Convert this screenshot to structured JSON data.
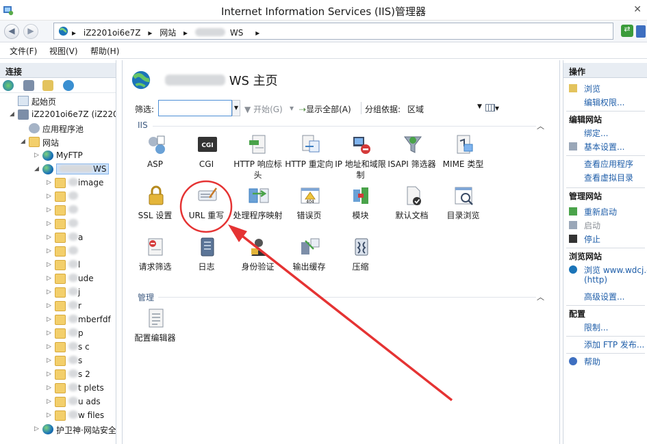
{
  "window": {
    "title": "Internet Information Services (IIS)管理器"
  },
  "address": {
    "crumbs": [
      "iZ2201oi6e7Z",
      "网站",
      "WS"
    ]
  },
  "menu": {
    "file": "文件(F)",
    "view": "视图(V)",
    "help": "帮助(H)"
  },
  "connections": {
    "header": "连接",
    "tree": [
      {
        "label": "起始页",
        "level": 1,
        "kind": "page"
      },
      {
        "label": "iZ2201oi6e7Z (iZ2201",
        "level": 1,
        "kind": "server"
      },
      {
        "label": "应用程序池",
        "level": 2,
        "kind": "pool"
      },
      {
        "label": "网站",
        "level": 2,
        "kind": "folder"
      },
      {
        "label": "MyFTP",
        "level": 3,
        "kind": "site"
      },
      {
        "label": "WS",
        "level": 3,
        "kind": "site-selected"
      },
      {
        "label": "image",
        "level": 4,
        "kind": "folder"
      },
      {
        "label": "",
        "level": 4,
        "kind": "folder"
      },
      {
        "label": "",
        "level": 4,
        "kind": "folder"
      },
      {
        "label": "",
        "level": 4,
        "kind": "folder"
      },
      {
        "label": "a",
        "level": 4,
        "kind": "folder"
      },
      {
        "label": "",
        "level": 4,
        "kind": "folder"
      },
      {
        "label": "l",
        "level": 4,
        "kind": "folder"
      },
      {
        "label": "ude",
        "level": 4,
        "kind": "folder"
      },
      {
        "label": "j",
        "level": 4,
        "kind": "folder"
      },
      {
        "label": "r",
        "level": 4,
        "kind": "folder"
      },
      {
        "label": "mberfdf",
        "level": 4,
        "kind": "folder"
      },
      {
        "label": "p",
        "level": 4,
        "kind": "folder"
      },
      {
        "label": "s  c",
        "level": 4,
        "kind": "folder"
      },
      {
        "label": "s",
        "level": 4,
        "kind": "folder"
      },
      {
        "label": "s  2",
        "level": 4,
        "kind": "folder"
      },
      {
        "label": "t  plets",
        "level": 4,
        "kind": "folder"
      },
      {
        "label": "u  ads",
        "level": 4,
        "kind": "folder"
      },
      {
        "label": "w  files",
        "level": 4,
        "kind": "folder"
      },
      {
        "label": "护卫神·网站安全",
        "level": 3,
        "kind": "site"
      }
    ]
  },
  "center": {
    "title_suffix": "WS 主页",
    "filter": {
      "label": "筛选:",
      "value": "",
      "start": "开始(G)",
      "show_all": "显示全部(A)",
      "group_by": "分组依据:",
      "group_value": "区域"
    },
    "groups": [
      {
        "name": "IIS",
        "features": [
          "ASP",
          "CGI",
          "HTTP 响应标头",
          "HTTP 重定向",
          "IP 地址和域限制",
          "ISAPI 筛选器",
          "MIME 类型",
          "SSL 设置",
          "URL 重写",
          "处理程序映射",
          "错误页",
          "模块",
          "默认文档",
          "目录浏览",
          "请求筛选",
          "日志",
          "身份验证",
          "输出缓存",
          "压缩"
        ]
      },
      {
        "name": "管理",
        "features": [
          "配置编辑器"
        ]
      }
    ],
    "icon_text": {
      "cgi": "CGI",
      "error_page": "404"
    }
  },
  "actions": {
    "header": "操作",
    "items": [
      {
        "label": "浏览",
        "style": "link",
        "icon": "folder-open-icon"
      },
      {
        "label": "编辑权限...",
        "style": "link"
      },
      {
        "label": "编辑网站",
        "style": "bold"
      },
      {
        "label": "绑定...",
        "style": "link"
      },
      {
        "label": "基本设置...",
        "style": "link",
        "icon": "settings-doc-icon"
      },
      {
        "label": "查看应用程序",
        "style": "link"
      },
      {
        "label": "查看虚拟目录",
        "style": "link"
      },
      {
        "label": "管理网站",
        "style": "bold"
      },
      {
        "label": "重新启动",
        "style": "link",
        "icon": "restart-icon"
      },
      {
        "label": "启动",
        "style": "disabled",
        "icon": "start-icon"
      },
      {
        "label": "停止",
        "style": "link",
        "icon": "stop-icon"
      },
      {
        "label": "浏览网站",
        "style": "bold"
      },
      {
        "label": "浏览 www.wdcj.c",
        "style": "link",
        "icon": "browse-globe-icon"
      },
      {
        "label": "(http)",
        "style": "link"
      },
      {
        "label": "高级设置...",
        "style": "link"
      },
      {
        "label": "配置",
        "style": "bold"
      },
      {
        "label": "限制...",
        "style": "link"
      },
      {
        "label": "添加 FTP 发布...",
        "style": "link"
      },
      {
        "label": "帮助",
        "style": "link",
        "icon": "help-icon"
      }
    ]
  },
  "colors": {
    "accent": "#1f5ea9",
    "annotation": "#e53333"
  }
}
